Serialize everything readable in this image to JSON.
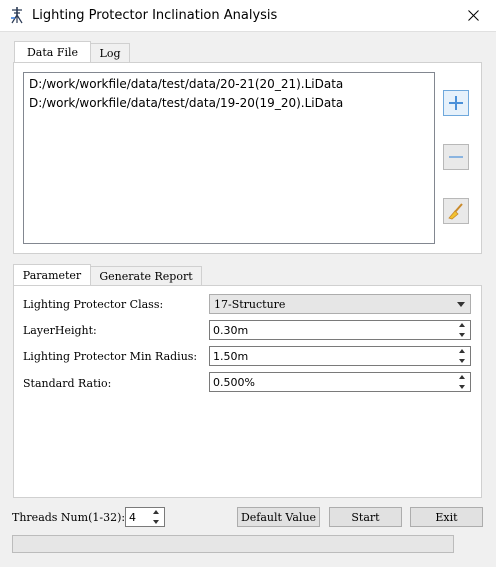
{
  "window": {
    "title": "Lighting Protector Inclination Analysis"
  },
  "top_tabs": {
    "data_file": "Data File",
    "log": "Log"
  },
  "files": [
    "D:/work/workfile/data/test/data/20-21(20_21).LiData",
    "D:/work/workfile/data/test/data/19-20(19_20).LiData"
  ],
  "bottom_tabs": {
    "parameter": "Parameter",
    "report": "Generate Report"
  },
  "params": {
    "class_label": "Lighting Protector Class:",
    "class_value": "17-Structure",
    "layer_label": "LayerHeight:",
    "layer_value": "0.30m",
    "radius_label": "Lighting Protector Min Radius:",
    "radius_value": "1.50m",
    "ratio_label": "Standard Ratio:",
    "ratio_value": "0.500%"
  },
  "footer": {
    "threads_label": "Threads Num(1-32):",
    "threads_value": "4",
    "default_btn": "Default Value",
    "start_btn": "Start",
    "exit_btn": "Exit"
  },
  "progress": 0,
  "icons": {
    "add": "plus-icon",
    "remove": "minus-icon",
    "clear": "broom-icon",
    "close": "close-icon",
    "app": "app-icon"
  }
}
